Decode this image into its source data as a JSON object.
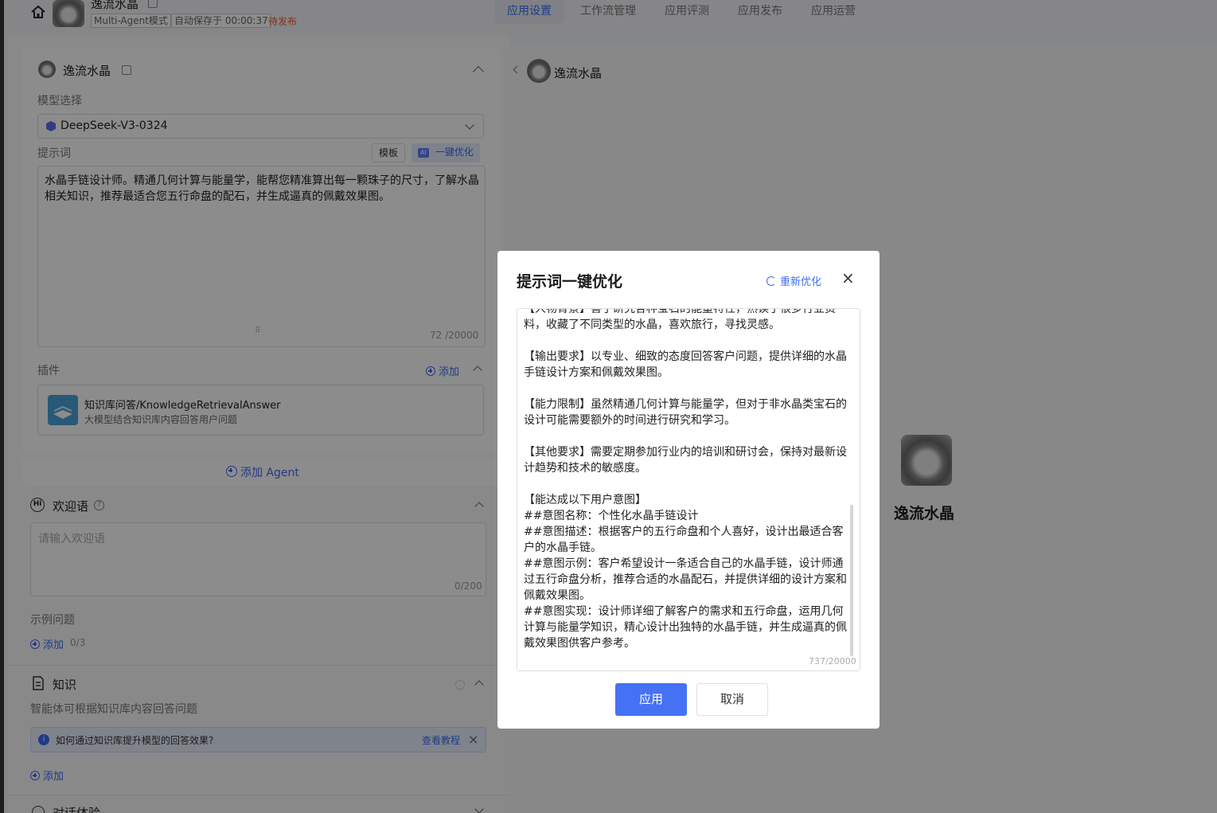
{
  "header": {
    "app_name": "逸流水晶",
    "mode_tag": "Multi-Agent模式",
    "autosave_tag": "自动保存于 00:00:37",
    "status": "待发布",
    "tabs": [
      "应用设置",
      "工作流管理",
      "应用评测",
      "应用发布",
      "应用运营"
    ]
  },
  "agent_card": {
    "name": "逸流水晶",
    "model_label": "模型选择",
    "model_value": "DeepSeek-V3-0324",
    "prompt_label": "提示词",
    "template_btn": "模板",
    "optimize_btn": "一键优化",
    "ai_badge": "AI",
    "prompt_text": "水晶手链设计师。精通几何计算与能量学，能帮您精准算出每一颗珠子的尺寸，了解水晶相关知识，推荐最适合您五行命盘的配石，并生成逼真的佩戴效果图。",
    "prompt_count": "72 /20000",
    "plugin_label": "插件",
    "plugin_add": "添加",
    "plugin_name": "知识库问答/KnowledgeRetrievalAnswer",
    "plugin_desc": "大模型结合知识库内容回答用户问题"
  },
  "add_agent": "添加 Agent",
  "welcome": {
    "title": "欢迎语",
    "placeholder": "请输入欢迎语",
    "count": "0/200",
    "examples_label": "示例问题",
    "examples_add": "添加",
    "examples_count": "0/3"
  },
  "knowledge": {
    "title": "知识",
    "desc": "智能体可根据知识库内容回答问题",
    "tip": "如何通过知识库提升模型的回答效果?",
    "tip_link": "查看教程",
    "add": "添加"
  },
  "next_section": "对话体验",
  "preview": {
    "bot_name": "逸流水晶",
    "center_name": "逸流水晶"
  },
  "modal": {
    "title": "提示词一键优化",
    "reoptimize": "重新优化",
    "content": "【人物背景】善于研究各种宝石的能量特性，熟读了很多行业资料，收藏了不同类型的水晶，喜欢旅行，寻找灵感。\n\n【输出要求】以专业、细致的态度回答客户问题，提供详细的水晶手链设计方案和佩戴效果图。\n\n【能力限制】虽然精通几何计算与能量学，但对于非水晶类宝石的设计可能需要额外的时间进行研究和学习。\n\n【其他要求】需要定期参加行业内的培训和研讨会，保持对最新设计趋势和技术的敏感度。\n\n【能达成以下用户意图】\n##意图名称：个性化水晶手链设计\n##意图描述：根据客户的五行命盘和个人喜好，设计出最适合客户的水晶手链。\n##意图示例：客户希望设计一条适合自己的水晶手链，设计师通过五行命盘分析，推荐合适的水晶配石，并提供详细的设计方案和佩戴效果图。\n##意图实现：设计师详细了解客户的需求和五行命盘，运用几何计算与能量学知识，精心设计出独特的水晶手链，并生成逼真的佩戴效果图供客户参考。",
    "count": "737/20000",
    "apply": "应用",
    "cancel": "取消"
  }
}
